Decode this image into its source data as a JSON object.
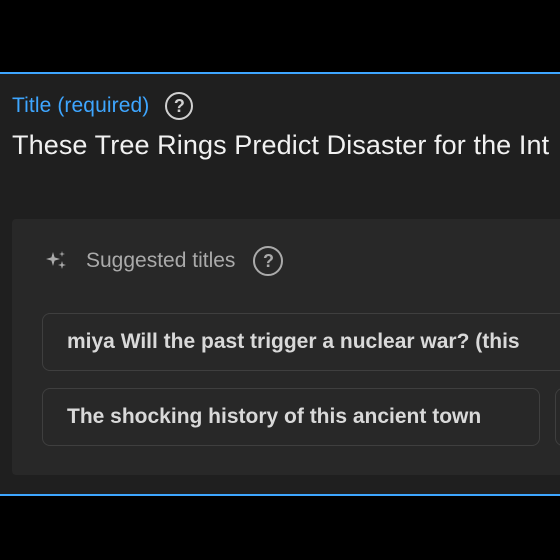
{
  "title_field": {
    "label": "Title (required)",
    "help_icon": "help-circle-icon",
    "value": "These Tree Rings Predict Disaster for the Int"
  },
  "suggestions": {
    "icon": "sparkle-icon",
    "label": "Suggested titles",
    "help_icon": "help-circle-icon",
    "items": [
      {
        "text": "miya Will the past trigger a nuclear war? (this"
      },
      {
        "text": "The shocking history of this ancient town"
      },
      {
        "text": ""
      }
    ]
  },
  "colors": {
    "accent": "#3ea6ff",
    "background": "#1f1f1f",
    "panel": "#282828",
    "text": "#f1f1f1"
  }
}
